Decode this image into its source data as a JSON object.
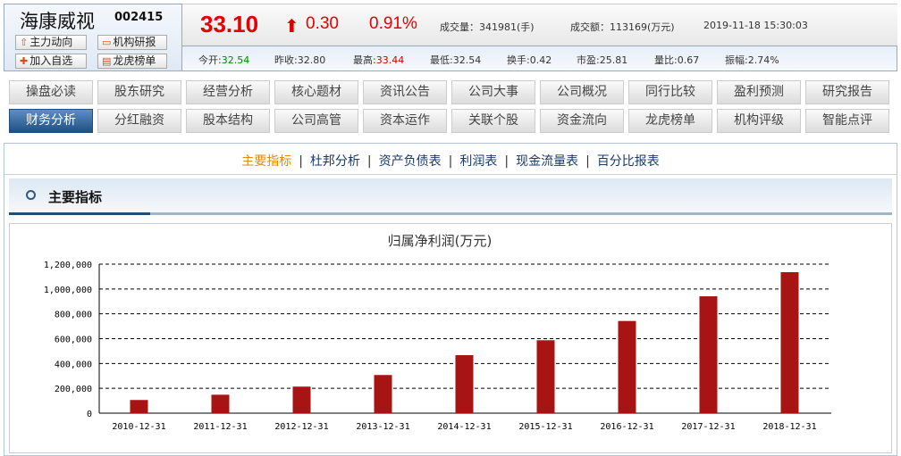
{
  "stock": {
    "name": "海康威视",
    "code": "002415",
    "price": "33.10",
    "change": "0.30",
    "change_pct": "0.91%",
    "volume_label": "成交量：",
    "volume": "341981(手)",
    "amount_label": "成交额：",
    "amount": "113169(万元)",
    "datetime": "2019-11-18 15:30:03"
  },
  "quick_buttons": [
    {
      "label": "主力动向",
      "icon": "arrow-up-icon"
    },
    {
      "label": "机构研报",
      "icon": "report-icon"
    },
    {
      "label": "加入自选",
      "icon": "plus-icon"
    },
    {
      "label": "龙虎榜单",
      "icon": "chart-icon"
    }
  ],
  "stats": [
    {
      "label": "今开:",
      "value": "32.54",
      "color": "#008800"
    },
    {
      "label": "昨收:",
      "value": "32.80",
      "color": "#333333"
    },
    {
      "label": "最高:",
      "value": "33.44",
      "color": "#cc0000"
    },
    {
      "label": "最低:",
      "value": "32.54",
      "color": "#333333"
    },
    {
      "label": "换手:",
      "value": "0.42",
      "color": "#333333"
    },
    {
      "label": "市盈:",
      "value": "25.81",
      "color": "#333333"
    },
    {
      "label": "量比:",
      "value": "0.67",
      "color": "#333333"
    },
    {
      "label": "振幅:",
      "value": "2.74%",
      "color": "#333333"
    }
  ],
  "nav": [
    [
      "操盘必读",
      "股东研究",
      "经营分析",
      "核心题材",
      "资讯公告",
      "公司大事",
      "公司概况",
      "同行比较",
      "盈利预测",
      "研究报告"
    ],
    [
      "财务分析",
      "分红融资",
      "股本结构",
      "公司高管",
      "资本运作",
      "关联个股",
      "资金流向",
      "龙虎榜单",
      "机构评级",
      "智能点评"
    ]
  ],
  "nav_active": "财务分析",
  "subtabs": [
    "主要指标",
    "杜邦分析",
    "资产负债表",
    "利润表",
    "现金流量表",
    "百分比报表"
  ],
  "subtab_active": "主要指标",
  "section_title": "主要指标",
  "colors": {
    "up": "#e60000",
    "bar": "#a81414",
    "active_tab": "#e08a00"
  },
  "chart_data": {
    "type": "bar",
    "title": "归属净利润(万元)",
    "categories": [
      "2010-12-31",
      "2011-12-31",
      "2012-12-31",
      "2013-12-31",
      "2014-12-31",
      "2015-12-31",
      "2016-12-31",
      "2017-12-31",
      "2018-12-31"
    ],
    "values": [
      106016,
      148419,
      213778,
      307233,
      467178,
      587176,
      742240,
      941071,
      1135253
    ],
    "yticks": [
      "0",
      "200,000",
      "400,000",
      "600,000",
      "800,000",
      "1,000,000",
      "1,200,000"
    ],
    "ylim": [
      0,
      1200000
    ],
    "grid": "dashed horizontal",
    "xlabel": "",
    "ylabel": ""
  }
}
